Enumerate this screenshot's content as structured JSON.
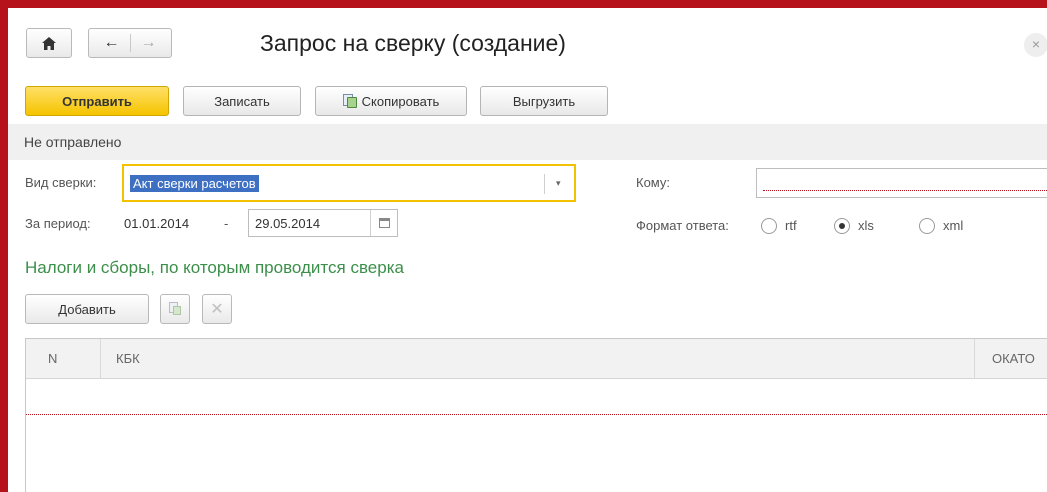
{
  "window": {
    "title": "Запрос на сверку (создание)",
    "close_symbol": "×"
  },
  "toolbar": {
    "send_label": "Отправить",
    "save_label": "Записать",
    "copy_label": "Скопировать",
    "export_label": "Выгрузить"
  },
  "status": {
    "text": "Не отправлено"
  },
  "form": {
    "vid_label": "Вид сверки:",
    "vid_value": "Акт сверки расчетов",
    "komu_label": "Кому:",
    "komu_value": "",
    "period_label": "За период:",
    "period_from": "01.01.2014",
    "period_dash": "-",
    "period_to": "29.05.2014",
    "format_label": "Формат ответа:",
    "format_options": [
      "rtf",
      "xls",
      "xml"
    ],
    "format_selected": "xls"
  },
  "taxes": {
    "section_title": "Налоги и сборы, по которым проводится сверка",
    "add_label": "Добавить",
    "delete_symbol": "✕",
    "columns": [
      "N",
      "КБК",
      "ОКАТО"
    ],
    "rows": []
  },
  "colors": {
    "accent_yellow": "#f5c400",
    "frame_red": "#b5121b",
    "section_green": "#3c8f4a",
    "selection_blue": "#3d6fc2"
  },
  "icons": [
    "home-icon",
    "back-arrow-icon",
    "forward-arrow-icon",
    "close-icon",
    "copy-icon",
    "dropdown-arrow-icon",
    "calendar-icon",
    "copy-row-icon",
    "delete-icon"
  ]
}
